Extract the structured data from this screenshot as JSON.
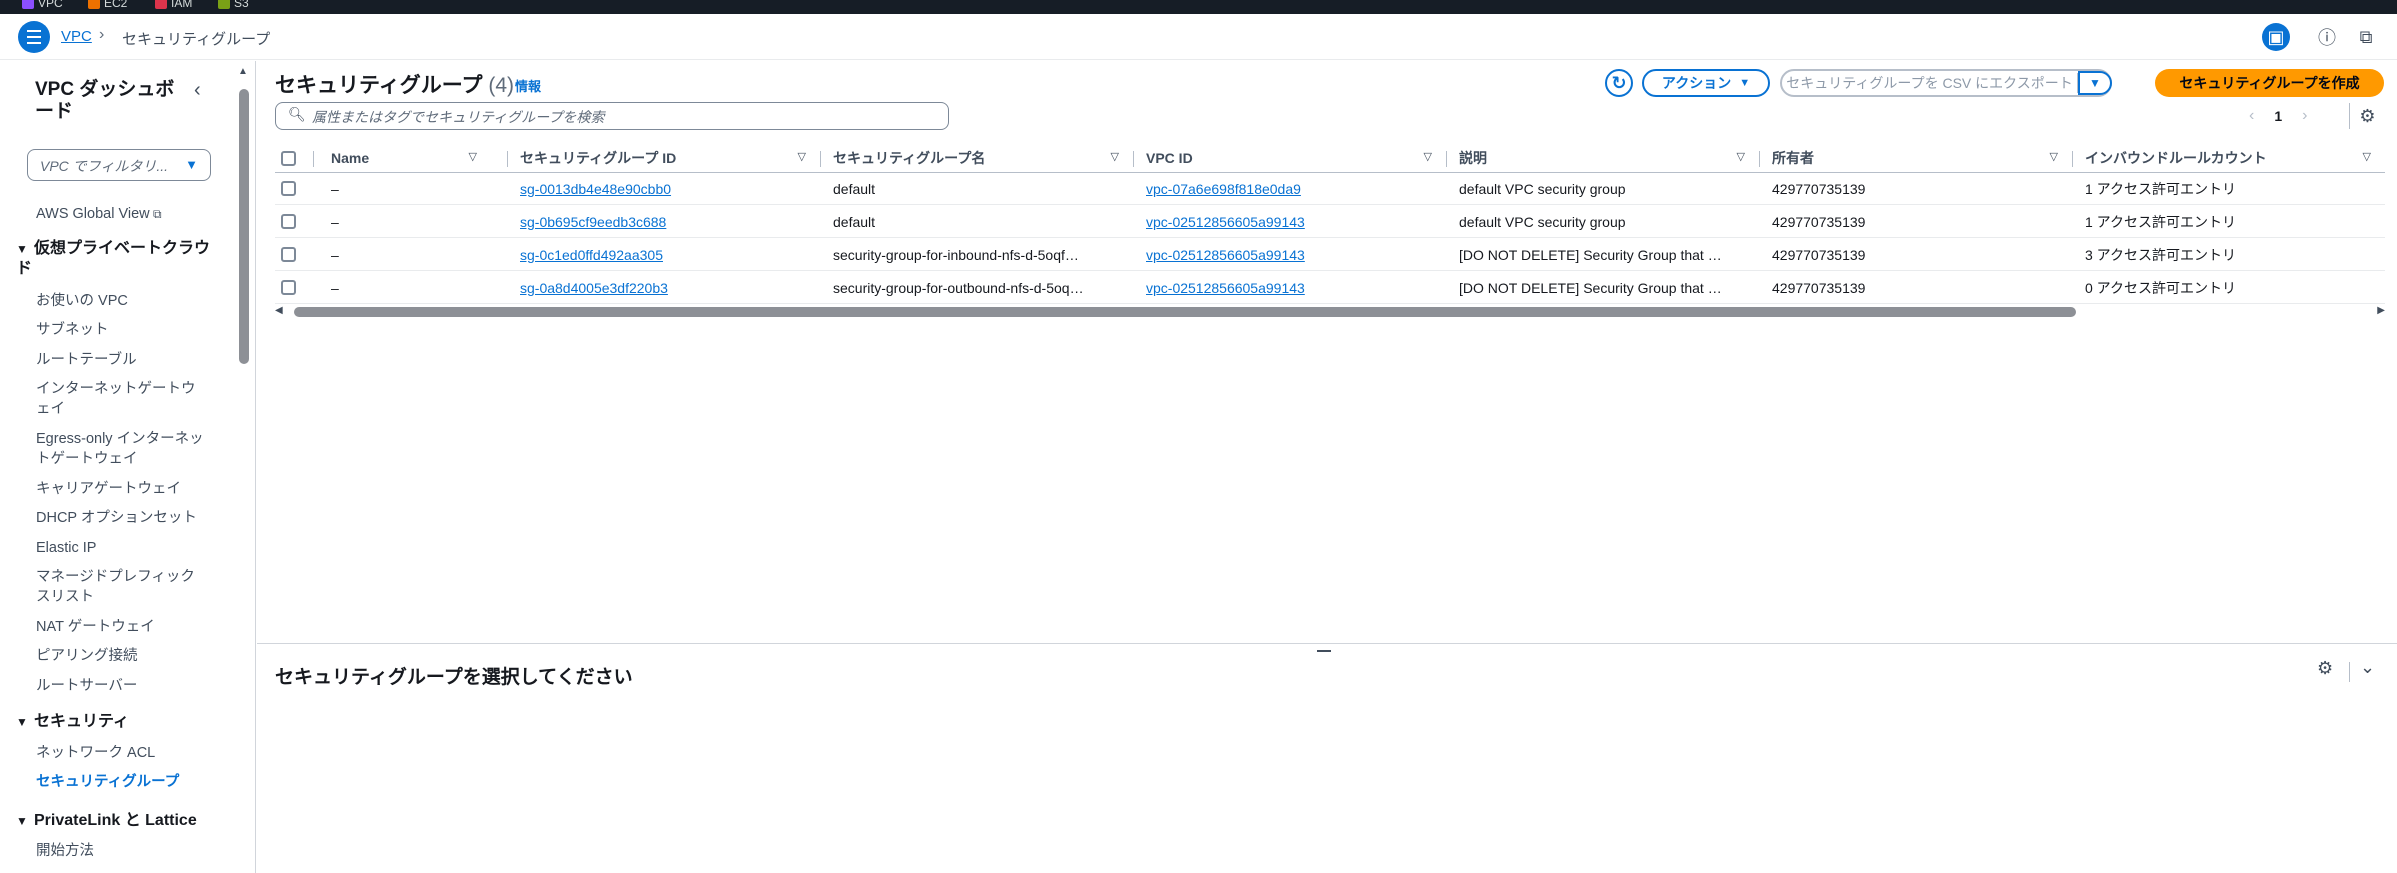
{
  "topbar": {
    "services": [
      {
        "label": "VPC",
        "color": "#8c4fff"
      },
      {
        "label": "EC2",
        "color": "#ed7100"
      },
      {
        "label": "IAM",
        "color": "#dd344c"
      },
      {
        "label": "S3",
        "color": "#7aa116"
      }
    ]
  },
  "breadcrumb": {
    "root": "VPC",
    "current": "セキュリティグループ"
  },
  "sidebar": {
    "title": "VPC ダッシュボード",
    "filter_placeholder": "VPC でフィルタリ...",
    "global_view": "AWS Global View",
    "section_vpc": "仮想プライベートクラウド",
    "vpc_items": [
      "お使いの VPC",
      "サブネット",
      "ルートテーブル",
      "インターネットゲートウェイ",
      "Egress-only インターネットゲートウェイ",
      "キャリアゲートウェイ",
      "DHCP オプションセット",
      "Elastic IP",
      "マネージドプレフィックスリスト",
      "NAT ゲートウェイ",
      "ピアリング接続",
      "ルートサーバー"
    ],
    "section_security": "セキュリティ",
    "security_items": [
      "ネットワーク ACL",
      "セキュリティグループ"
    ],
    "section_privatelink": "PrivateLink と Lattice",
    "privatelink_items": [
      "開始方法"
    ]
  },
  "main": {
    "title": "セキュリティグループ",
    "count": "(4)",
    "info": "情報",
    "actions_label": "アクション",
    "export_label": "セキュリティグループを CSV にエクスポート",
    "create_label": "セキュリティグループを作成",
    "search_placeholder": "属性またはタグでセキュリティグループを検索",
    "page": "1",
    "columns": [
      "Name",
      "セキュリティグループ ID",
      "セキュリティグループ名",
      "VPC ID",
      "説明",
      "所有者",
      "インバウンドルールカウント"
    ],
    "rows": [
      {
        "name": "–",
        "sg_id": "sg-0013db4e48e90cbb0",
        "sg_name": "default",
        "vpc_id": "vpc-07a6e698f818e0da9",
        "desc": "default VPC security group",
        "owner": "429770735139",
        "inbound": "1 アクセス許可エントリ"
      },
      {
        "name": "–",
        "sg_id": "sg-0b695cf9eedb3c688",
        "sg_name": "default",
        "vpc_id": "vpc-02512856605a99143",
        "desc": "default VPC security group",
        "owner": "429770735139",
        "inbound": "1 アクセス許可エントリ"
      },
      {
        "name": "–",
        "sg_id": "sg-0c1ed0ffd492aa305",
        "sg_name": "security-group-for-inbound-nfs-d-5oqf…",
        "vpc_id": "vpc-02512856605a99143",
        "desc": "[DO NOT DELETE] Security Group that …",
        "owner": "429770735139",
        "inbound": "3 アクセス許可エントリ"
      },
      {
        "name": "–",
        "sg_id": "sg-0a8d4005e3df220b3",
        "sg_name": "security-group-for-outbound-nfs-d-5oq…",
        "vpc_id": "vpc-02512856605a99143",
        "desc": "[DO NOT DELETE] Security Group that …",
        "owner": "429770735139",
        "inbound": "0 アクセス許可エントリ"
      }
    ]
  },
  "split": {
    "title": "セキュリティグループを選択してください"
  }
}
